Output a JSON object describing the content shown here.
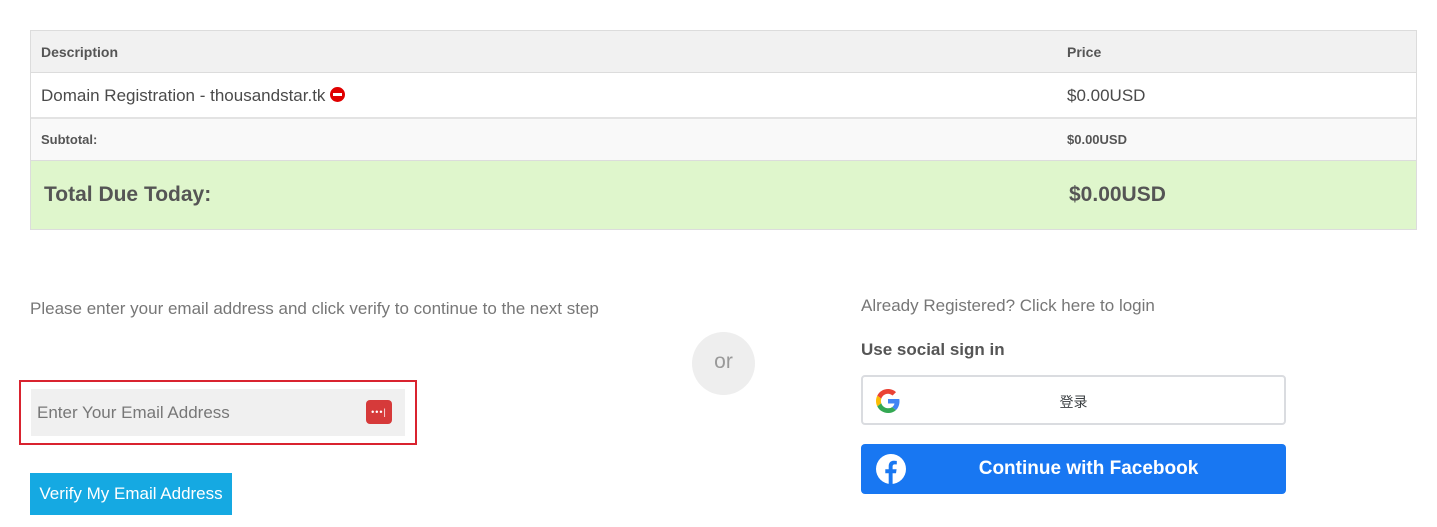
{
  "order": {
    "header": {
      "description": "Description",
      "price": "Price"
    },
    "items": [
      {
        "description": "Domain Registration - thousandstar.tk",
        "price": "$0.00USD",
        "remove_icon": "remove-icon"
      }
    ],
    "subtotal": {
      "label": "Subtotal:",
      "value": "$0.00USD"
    },
    "total": {
      "label": "Total Due Today:",
      "value": "$0.00USD"
    }
  },
  "email_step": {
    "prompt": "Please enter your email address and click verify to continue to the next step",
    "input_placeholder": "Enter Your Email Address",
    "input_value": "",
    "password_manager_icon": "password-manager-icon",
    "verify_label": "Verify My Email Address"
  },
  "divider": {
    "label": "or"
  },
  "login": {
    "link": "Already Registered? Click here to login",
    "social_heading": "Use social sign in",
    "google_label": "登录",
    "facebook_label": "Continue with Facebook"
  },
  "colors": {
    "total_bg": "#dff6cc",
    "verify_button": "#15a9e2",
    "facebook": "#1877f2",
    "email_outline": "#d9232f",
    "remove": "#e00000"
  }
}
